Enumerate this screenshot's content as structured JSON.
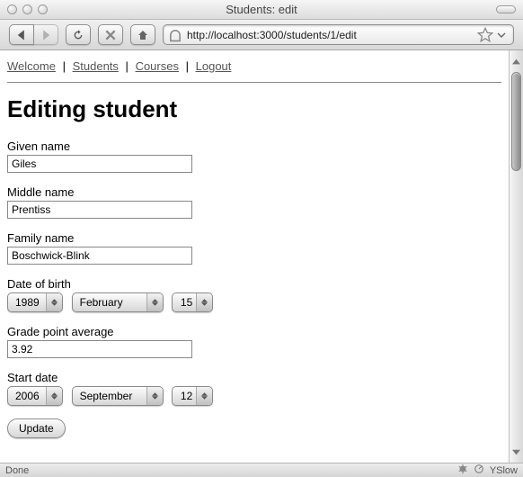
{
  "window": {
    "title": "Students: edit"
  },
  "toolbar": {
    "url": "http://localhost:3000/students/1/edit"
  },
  "nav": {
    "links": [
      "Welcome",
      "Students",
      "Courses",
      "Logout"
    ]
  },
  "page": {
    "heading": "Editing student"
  },
  "form": {
    "given_name": {
      "label": "Given name",
      "value": "Giles"
    },
    "middle_name": {
      "label": "Middle name",
      "value": "Prentiss"
    },
    "family_name": {
      "label": "Family name",
      "value": "Boschwick-Blink"
    },
    "date_of_birth": {
      "label": "Date of birth",
      "year": "1989",
      "month": "February",
      "day": "15"
    },
    "gpa": {
      "label": "Grade point average",
      "value": "3.92"
    },
    "start_date": {
      "label": "Start date",
      "year": "2006",
      "month": "September",
      "day": "12"
    },
    "submit_label": "Update"
  },
  "status": {
    "left": "Done",
    "right_label": "YSlow"
  }
}
